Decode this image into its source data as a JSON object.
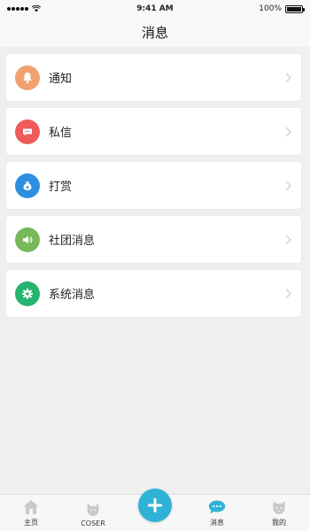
{
  "status_bar": {
    "time": "9:41 AM",
    "battery": "100%"
  },
  "nav": {
    "title": "消息"
  },
  "list": [
    {
      "label": "通知",
      "icon": "bell-icon",
      "color": "#f0a16f"
    },
    {
      "label": "私信",
      "icon": "chat-icon",
      "color": "#ef5a5a"
    },
    {
      "label": "打赏",
      "icon": "reward-icon",
      "color": "#2e8ee0"
    },
    {
      "label": "社团消息",
      "icon": "speaker-icon",
      "color": "#77b85a"
    },
    {
      "label": "系统消息",
      "icon": "gear-icon",
      "color": "#25b36f"
    }
  ],
  "tabs": [
    {
      "label": "主页",
      "icon": "home-icon"
    },
    {
      "label": "COSER",
      "icon": "coser-icon"
    },
    {
      "label": "",
      "icon": "plus-icon"
    },
    {
      "label": "消息",
      "icon": "message-icon"
    },
    {
      "label": "我的",
      "icon": "profile-icon"
    }
  ]
}
